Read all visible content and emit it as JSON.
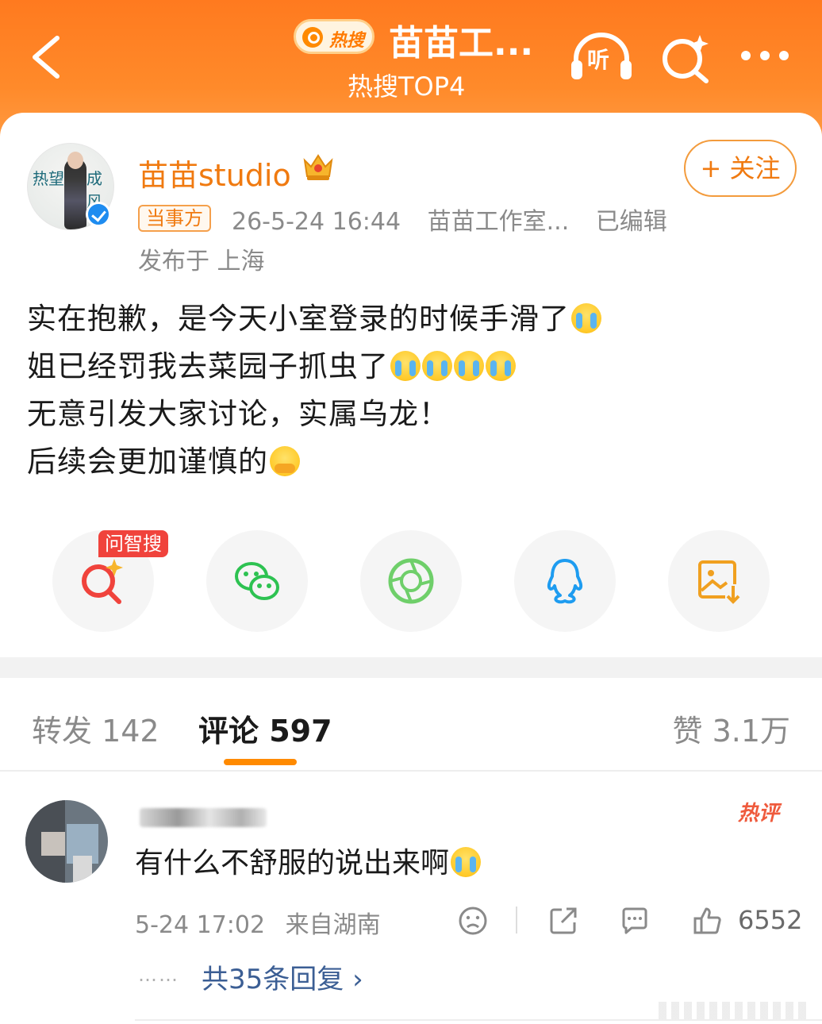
{
  "header": {
    "hot_badge": "热搜",
    "topic_title": "苗苗工...",
    "topic_subtitle": "热搜TOP4",
    "listen_label": "听"
  },
  "post": {
    "author": "苗苗studio",
    "party_tag": "当事方",
    "follow_label": "+ 关注",
    "date": "26-5-24 16:44",
    "source": "苗苗工作室...",
    "edited": "已编辑",
    "location": "发布于 上海",
    "avatar_text_left": "热望",
    "avatar_text_right": "成风",
    "lines": [
      "实在抱歉，是今天小室登录的时候手滑了",
      "姐已经罚我去菜园子抓虫了",
      "无意引发大家讨论，实属乌龙！",
      "后续会更加谨慎的"
    ]
  },
  "share": {
    "ask_tag": "问智搜"
  },
  "tabs": {
    "repost": "转发 142",
    "comment": "评论 597",
    "like": "赞 3.1万"
  },
  "comment": {
    "hot_badge": "热评",
    "text": "有什么不舒服的说出来啊",
    "date": "5-24 17:02",
    "from": "来自湖南",
    "like_count": "6552",
    "dots": "……",
    "reply_link": "共35条回复 ›"
  },
  "colors": {
    "header_orange": "#ff7a1f",
    "accent_orange": "#f07a10",
    "link_blue": "#3b5e94",
    "verified_blue": "#1e8cf0",
    "hot_red": "#ef5a3c"
  },
  "icons": [
    "back-arrow-icon",
    "listen-headphone-icon",
    "ai-search-icon",
    "more-dots-icon",
    "crown-badge-icon",
    "verified-icon",
    "wechat-icon",
    "moments-icon",
    "qq-icon",
    "save-image-icon",
    "dislike-face-icon",
    "share-icon",
    "comment-icon",
    "thumbs-up-icon"
  ]
}
